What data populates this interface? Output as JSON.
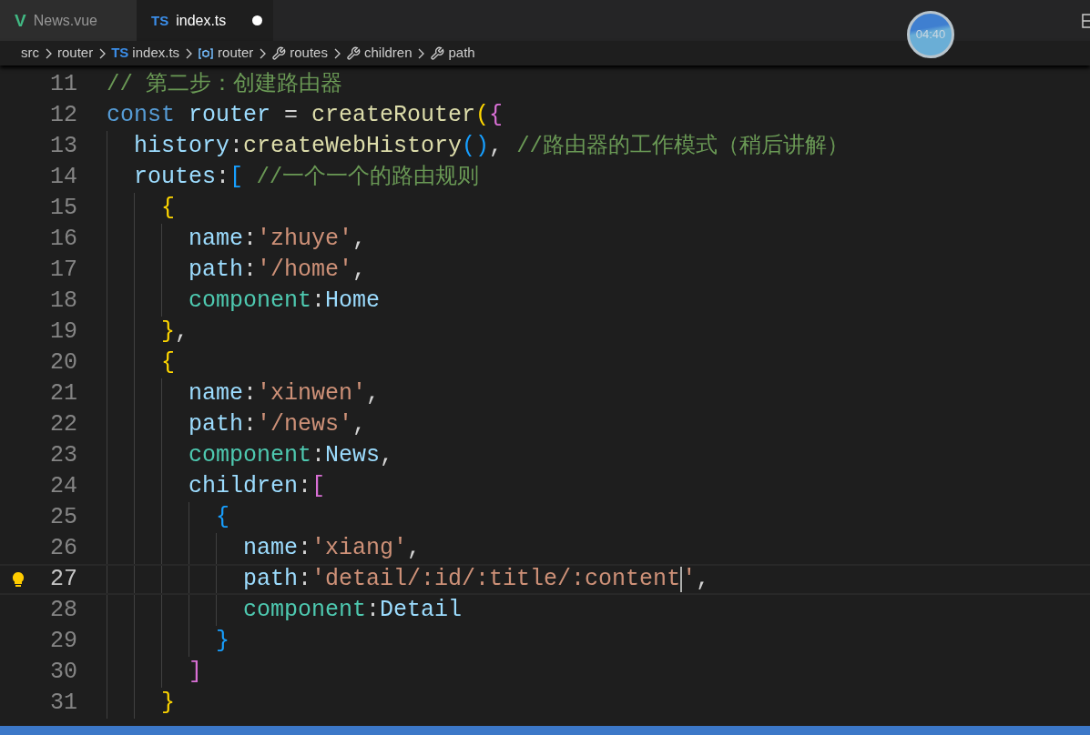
{
  "tabs": [
    {
      "label": "News.vue",
      "icon_text": "V",
      "kind": "vue",
      "selected": false,
      "modified": false
    },
    {
      "label": "index.ts",
      "icon_text": "TS",
      "kind": "ts",
      "selected": true,
      "modified": true
    }
  ],
  "breadcrumb": [
    {
      "label": "src",
      "kind": "plain"
    },
    {
      "label": "router",
      "kind": "plain"
    },
    {
      "label": "index.ts",
      "kind": "ts",
      "icon_text": "TS"
    },
    {
      "label": "router",
      "kind": "variable"
    },
    {
      "label": "routes",
      "kind": "property"
    },
    {
      "label": "children",
      "kind": "property"
    },
    {
      "label": "path",
      "kind": "property"
    }
  ],
  "timer": "04:40",
  "lines": [
    {
      "number": "11",
      "active": false,
      "tokens": [
        {
          "text": "// 第二步：创建路由器",
          "kind": "comment"
        }
      ]
    },
    {
      "number": "12",
      "active": false,
      "tokens": [
        {
          "text": "const",
          "kind": "keyword"
        },
        {
          "text": " router",
          "kind": "variable"
        },
        {
          "text": " = ",
          "kind": "punct"
        },
        {
          "text": "createRouter",
          "kind": "function"
        },
        {
          "text": "(",
          "kind": "bracket1"
        },
        {
          "text": "{",
          "kind": "bracket2"
        }
      ]
    },
    {
      "number": "13",
      "active": false,
      "tokens": [
        {
          "text": "  history",
          "kind": "variable"
        },
        {
          "text": ":",
          "kind": "punct"
        },
        {
          "text": "createWebHistory",
          "kind": "function"
        },
        {
          "text": "()",
          "kind": "bracket3"
        },
        {
          "text": ", ",
          "kind": "punct"
        },
        {
          "text": "//路由器的工作模式（稍后讲解）",
          "kind": "comment"
        }
      ]
    },
    {
      "number": "14",
      "active": false,
      "tokens": [
        {
          "text": "  routes",
          "kind": "variable"
        },
        {
          "text": ":",
          "kind": "punct"
        },
        {
          "text": "[",
          "kind": "bracket3"
        },
        {
          "text": " //一个一个的路由规则",
          "kind": "comment"
        }
      ]
    },
    {
      "number": "15",
      "active": false,
      "tokens": [
        {
          "text": "    {",
          "kind": "bracket1"
        }
      ]
    },
    {
      "number": "16",
      "active": false,
      "tokens": [
        {
          "text": "      name",
          "kind": "variable"
        },
        {
          "text": ":",
          "kind": "punct"
        },
        {
          "text": "'zhuye'",
          "kind": "string"
        },
        {
          "text": ",",
          "kind": "punct"
        }
      ]
    },
    {
      "number": "17",
      "active": false,
      "tokens": [
        {
          "text": "      path",
          "kind": "variable"
        },
        {
          "text": ":",
          "kind": "punct"
        },
        {
          "text": "'/home'",
          "kind": "string"
        },
        {
          "text": ",",
          "kind": "punct"
        }
      ]
    },
    {
      "number": "18",
      "active": false,
      "tokens": [
        {
          "text": "      component",
          "kind": "type"
        },
        {
          "text": ":",
          "kind": "punct"
        },
        {
          "text": "Home",
          "kind": "variable"
        }
      ]
    },
    {
      "number": "19",
      "active": false,
      "tokens": [
        {
          "text": "    }",
          "kind": "bracket1"
        },
        {
          "text": ",",
          "kind": "punct"
        }
      ]
    },
    {
      "number": "20",
      "active": false,
      "tokens": [
        {
          "text": "    {",
          "kind": "bracket1"
        }
      ]
    },
    {
      "number": "21",
      "active": false,
      "tokens": [
        {
          "text": "      name",
          "kind": "variable"
        },
        {
          "text": ":",
          "kind": "punct"
        },
        {
          "text": "'xinwen'",
          "kind": "string"
        },
        {
          "text": ",",
          "kind": "punct"
        }
      ]
    },
    {
      "number": "22",
      "active": false,
      "tokens": [
        {
          "text": "      path",
          "kind": "variable"
        },
        {
          "text": ":",
          "kind": "punct"
        },
        {
          "text": "'/news'",
          "kind": "string"
        },
        {
          "text": ",",
          "kind": "punct"
        }
      ]
    },
    {
      "number": "23",
      "active": false,
      "tokens": [
        {
          "text": "      component",
          "kind": "type"
        },
        {
          "text": ":",
          "kind": "punct"
        },
        {
          "text": "News",
          "kind": "variable"
        },
        {
          "text": ",",
          "kind": "punct"
        }
      ]
    },
    {
      "number": "24",
      "active": false,
      "tokens": [
        {
          "text": "      children",
          "kind": "variable"
        },
        {
          "text": ":",
          "kind": "punct"
        },
        {
          "text": "[",
          "kind": "bracket2"
        }
      ]
    },
    {
      "number": "25",
      "active": false,
      "tokens": [
        {
          "text": "        {",
          "kind": "bracket3"
        }
      ]
    },
    {
      "number": "26",
      "active": false,
      "tokens": [
        {
          "text": "          name",
          "kind": "variable"
        },
        {
          "text": ":",
          "kind": "punct"
        },
        {
          "text": "'xiang'",
          "kind": "string"
        },
        {
          "text": ",",
          "kind": "punct"
        }
      ]
    },
    {
      "number": "27",
      "active": true,
      "tokens": [
        {
          "text": "          path",
          "kind": "variable"
        },
        {
          "text": ":",
          "kind": "punct"
        },
        {
          "text": "'detail/:id/:title/:content",
          "kind": "string"
        },
        {
          "kind": "caret"
        },
        {
          "text": "'",
          "kind": "string"
        },
        {
          "text": ",",
          "kind": "punct"
        }
      ]
    },
    {
      "number": "28",
      "active": false,
      "tokens": [
        {
          "text": "          component",
          "kind": "type"
        },
        {
          "text": ":",
          "kind": "punct"
        },
        {
          "text": "Detail",
          "kind": "variable"
        }
      ]
    },
    {
      "number": "29",
      "active": false,
      "tokens": [
        {
          "text": "        }",
          "kind": "bracket3"
        }
      ]
    },
    {
      "number": "30",
      "active": false,
      "tokens": [
        {
          "text": "      ]",
          "kind": "bracket2"
        }
      ]
    },
    {
      "number": "31",
      "active": false,
      "tokens": [
        {
          "text": "    }",
          "kind": "bracket1"
        }
      ]
    }
  ]
}
